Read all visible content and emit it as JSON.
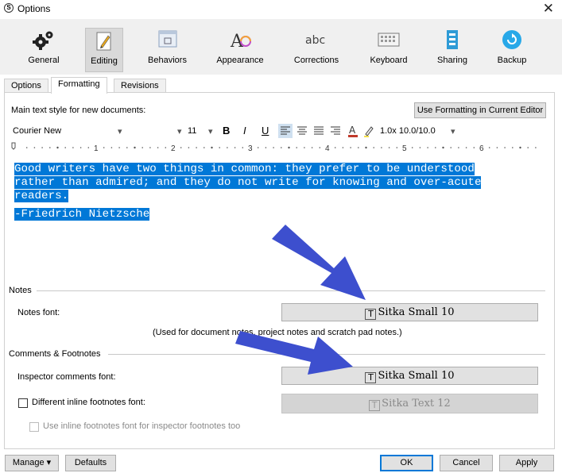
{
  "window": {
    "title": "Options",
    "app_icon_glyph": "S"
  },
  "toolbar": {
    "items": [
      {
        "label": "General",
        "icon": "gears-icon"
      },
      {
        "label": "Editing",
        "icon": "pencil-icon"
      },
      {
        "label": "Behaviors",
        "icon": "window-icon"
      },
      {
        "label": "Appearance",
        "icon": "font-palette-icon"
      },
      {
        "label": "Corrections",
        "icon": "abc-icon"
      },
      {
        "label": "Keyboard",
        "icon": "keyboard-icon"
      },
      {
        "label": "Sharing",
        "icon": "share-icon"
      },
      {
        "label": "Backup",
        "icon": "backup-icon"
      }
    ],
    "active": "Editing",
    "abc_glyph": "abc",
    "appearance_glyph": "A"
  },
  "subtabs": [
    "Options",
    "Formatting",
    "Revisions"
  ],
  "active_subtab": "Formatting",
  "formatting": {
    "main_text_label": "Main text style for new documents:",
    "use_formatting_button": "Use Formatting in Current Editor",
    "font_family": "Courier New",
    "font_size": "11",
    "bold": "B",
    "italic": "I",
    "underline": "U",
    "line_spacing": "1.0x 10.0/10.0",
    "dropdown_glyph": "▾",
    "ruler_marks": [
      "1",
      "2",
      "3",
      "4",
      "5",
      "6"
    ]
  },
  "sample_text": {
    "line1": "Good writers have two things in common: they prefer to be understood",
    "line2": "rather than admired; and they do not write for knowing and over-acute",
    "line3": "readers.",
    "attribution": "-Friedrich Nietzsche"
  },
  "notes": {
    "section_title": "Notes",
    "font_label": "Notes font:",
    "font_value": "Sitka Small 10",
    "hint": "(Used for document notes, project notes and scratch pad notes.)"
  },
  "comments": {
    "section_title": "Comments & Footnotes",
    "inspector_label": "Inspector comments font:",
    "inspector_value": "Sitka Small 10",
    "inline_label": "Different inline footnotes font:",
    "inline_value": "Sitka Text 12",
    "inspector_footnotes_label": "Use inline footnotes font for inspector footnotes too",
    "font_icon_glyph": "T"
  },
  "buttons": {
    "manage": "Manage",
    "defaults": "Defaults",
    "ok": "OK",
    "cancel": "Cancel",
    "apply": "Apply"
  },
  "colors": {
    "highlight": "#0078d7",
    "annotation_arrow": "#3d4fce"
  }
}
